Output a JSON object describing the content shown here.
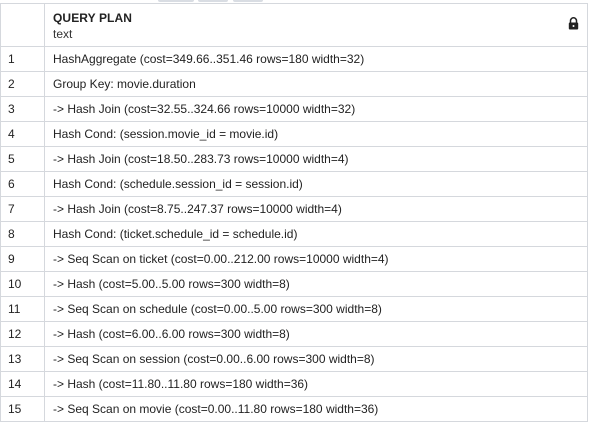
{
  "column": {
    "title": "QUERY PLAN",
    "type": "text",
    "lock_icon": "lock-icon"
  },
  "rows": [
    {
      "num": "1",
      "text": "HashAggregate (cost=349.66..351.46 rows=180 width=32)"
    },
    {
      "num": "2",
      "text": "Group Key: movie.duration"
    },
    {
      "num": "3",
      "text": "-> Hash Join (cost=32.55..324.66 rows=10000 width=32)"
    },
    {
      "num": "4",
      "text": "Hash Cond: (session.movie_id = movie.id)"
    },
    {
      "num": "5",
      "text": "-> Hash Join (cost=18.50..283.73 rows=10000 width=4)"
    },
    {
      "num": "6",
      "text": "Hash Cond: (schedule.session_id = session.id)"
    },
    {
      "num": "7",
      "text": "-> Hash Join (cost=8.75..247.37 rows=10000 width=4)"
    },
    {
      "num": "8",
      "text": "Hash Cond: (ticket.schedule_id = schedule.id)"
    },
    {
      "num": "9",
      "text": "-> Seq Scan on ticket (cost=0.00..212.00 rows=10000 width=4)"
    },
    {
      "num": "10",
      "text": "-> Hash (cost=5.00..5.00 rows=300 width=8)"
    },
    {
      "num": "11",
      "text": "-> Seq Scan on schedule (cost=0.00..5.00 rows=300 width=8)"
    },
    {
      "num": "12",
      "text": "-> Hash (cost=6.00..6.00 rows=300 width=8)"
    },
    {
      "num": "13",
      "text": "-> Seq Scan on session (cost=0.00..6.00 rows=300 width=8)"
    },
    {
      "num": "14",
      "text": "-> Hash (cost=11.80..11.80 rows=180 width=36)"
    },
    {
      "num": "15",
      "text": "-> Seq Scan on movie (cost=0.00..11.80 rows=180 width=36)"
    }
  ]
}
